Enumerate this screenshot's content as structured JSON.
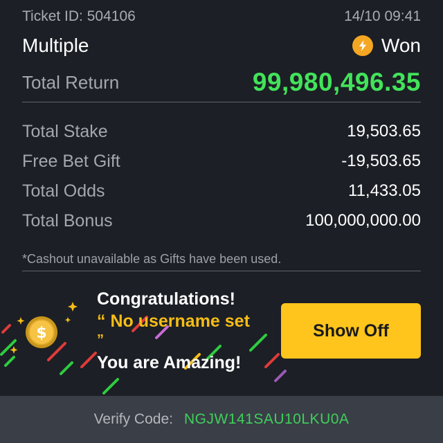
{
  "header": {
    "ticket_id": "Ticket ID: 504106",
    "datetime": "14/10 09:41",
    "bet_type": "Multiple",
    "status": "Won",
    "status_icon": "lightning-bolt-icon",
    "status_icon_color": "#f5a623"
  },
  "total_return": {
    "label": "Total Return",
    "value": "99,980,496.35",
    "color": "#42e35a"
  },
  "stats": [
    {
      "label": "Total Stake",
      "value": "19,503.65"
    },
    {
      "label": "Free Bet Gift",
      "value": "-19,503.65"
    },
    {
      "label": "Total Odds",
      "value": "11,433.05"
    },
    {
      "label": "Total Bonus",
      "value": "100,000,000.00"
    }
  ],
  "note": "*Cashout unavailable as Gifts have been used.",
  "promo": {
    "congrats": "Congratulations!",
    "username_line": "“ No username set",
    "quote_close": "”",
    "amazing": "You are Amazing!",
    "show_off_label": "Show Off",
    "coin_icon": "dollar-coin-icon",
    "accent_color": "#ffc51c"
  },
  "footer": {
    "verify_label": "Verify Code:",
    "verify_code": "NGJW141SAU10LKU0A",
    "code_color": "#3fcf5a"
  }
}
